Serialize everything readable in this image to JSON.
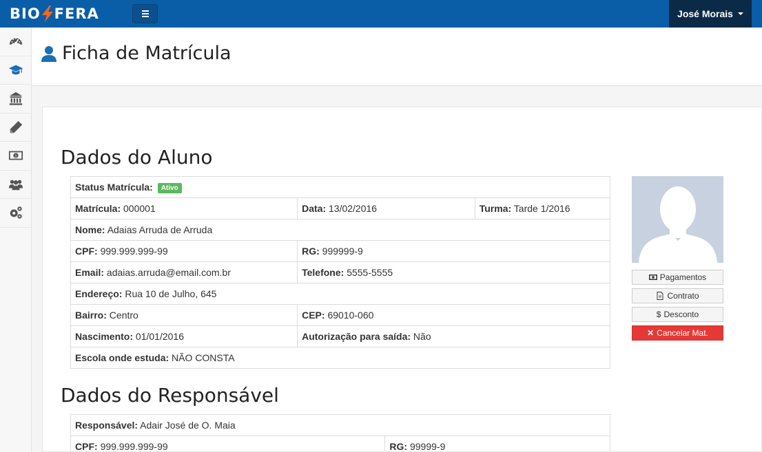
{
  "brand": {
    "left": "BIO",
    "right": "FERA"
  },
  "user": {
    "name": "José Morais"
  },
  "sidebar": {
    "items": [
      {
        "icon": "dashboard-icon",
        "color": "#555555"
      },
      {
        "icon": "graduation-cap-icon",
        "color": "#1a6fb5"
      },
      {
        "icon": "institution-icon",
        "color": "#555555"
      },
      {
        "icon": "pencil-icon",
        "color": "#555555"
      },
      {
        "icon": "money-icon",
        "color": "#555555"
      },
      {
        "icon": "users-icon",
        "color": "#555555"
      },
      {
        "icon": "gears-icon",
        "color": "#555555"
      }
    ]
  },
  "page": {
    "title": "Ficha de Matrícula"
  },
  "aluno": {
    "section_title": "Dados do Aluno",
    "status_label": "Status Matrícula:",
    "status_value": "Ativo",
    "matricula_label": "Matrícula:",
    "matricula_value": "000001",
    "data_label": "Data:",
    "data_value": "13/02/2016",
    "turma_label": "Turma:",
    "turma_value": "Tarde 1/2016",
    "nome_label": "Nome:",
    "nome_value": "Adaias Arruda de Arruda",
    "cpf_label": "CPF:",
    "cpf_value": "999.999.999-99",
    "rg_label": "RG:",
    "rg_value": "999999-9",
    "email_label": "Email:",
    "email_value": "adaias.arruda@email.com.br",
    "telefone_label": "Telefone:",
    "telefone_value": "5555-5555",
    "endereco_label": "Endereço:",
    "endereco_value": "Rua 10 de Julho, 645",
    "bairro_label": "Bairro:",
    "bairro_value": "Centro",
    "cep_label": "CEP:",
    "cep_value": "69010-060",
    "nascimento_label": "Nascimento:",
    "nascimento_value": "01/01/2016",
    "autorizacao_label": "Autorização para saída:",
    "autorizacao_value": "Não",
    "escola_label": "Escola onde estuda:",
    "escola_value": "NÃO CONSTA"
  },
  "actions": {
    "pagamentos": "Pagamentos",
    "contrato": "Contrato",
    "desconto": "Desconto",
    "cancelar": "Cancelar Mat."
  },
  "responsavel": {
    "section_title": "Dados do Responsável",
    "responsavel_label": "Responsável:",
    "responsavel_value": "Adair José de O. Maia",
    "cpf_label": "CPF:",
    "cpf_value": "999.999.999-99",
    "rg_label": "RG:",
    "rg_value": "99999-9"
  },
  "colors": {
    "topbar": "#0a5ea8",
    "user_menu": "#0b2a47",
    "badge": "#5cb85c",
    "danger": "#e53935"
  }
}
